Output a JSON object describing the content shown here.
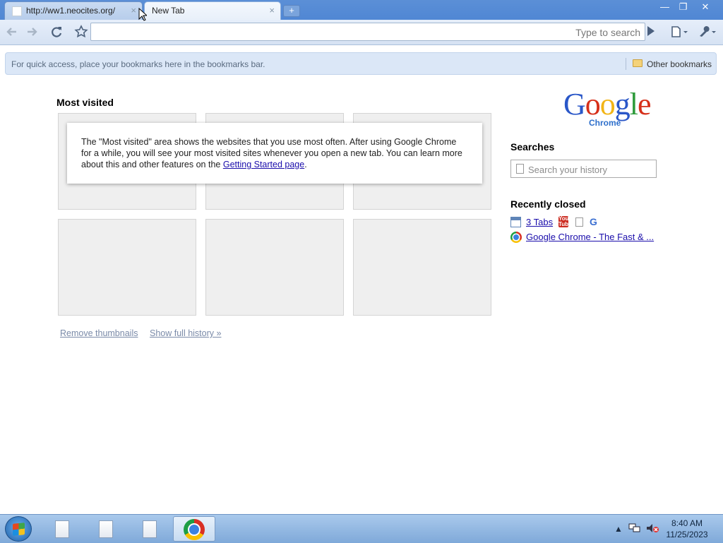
{
  "browser": {
    "tabs": [
      {
        "title": "http://ww1.neocites.org/",
        "close": "×"
      },
      {
        "title": "New Tab",
        "close": "×"
      }
    ],
    "new_tab_glyph": "+",
    "window_controls": {
      "minimize": "—",
      "maximize": "❐",
      "close": "✕"
    },
    "omnibox": {
      "value": "",
      "placeholder": "Type to search"
    },
    "toolbar_icons": [
      "back-arrow-icon",
      "forward-arrow-icon",
      "reload-icon",
      "star-icon",
      "go-icon",
      "page-menu-icon",
      "wrench-icon"
    ]
  },
  "bookmarks_bar": {
    "message": "For quick access, place your bookmarks here in the bookmarks bar.",
    "other_bookmarks": "Other bookmarks"
  },
  "most_visited": {
    "heading": "Most visited",
    "info_text_before": "The \"Most visited\" area shows the websites that you use most often. After using Google Chrome for a while, you will see your most visited sites whenever you open a new tab. You can learn more about this and other features on the ",
    "info_link": "Getting Started page",
    "info_text_after": ".",
    "remove_thumbnails": "Remove thumbnails",
    "show_full_history": "Show full history »"
  },
  "sidebar": {
    "logo_letters": [
      "G",
      "o",
      "o",
      "g",
      "l",
      "e"
    ],
    "logo_sub": "Chrome",
    "searches_heading": "Searches",
    "search_placeholder": "Search your history",
    "recently_closed_heading": "Recently closed",
    "recently_closed": [
      {
        "label": "3 Tabs"
      },
      {
        "label": "Google Chrome - The Fast & ..."
      }
    ]
  },
  "taskbar": {
    "clock_time": "8:40 AM",
    "clock_date": "11/25/2023",
    "tray_icons": [
      "show-hidden-icons-arrow",
      "network-icon",
      "volume-muted-icon"
    ]
  },
  "colors": {
    "titlebar": "#4f86d4",
    "link": "#1a0dab",
    "thumbnail_bg": "#efefef"
  }
}
